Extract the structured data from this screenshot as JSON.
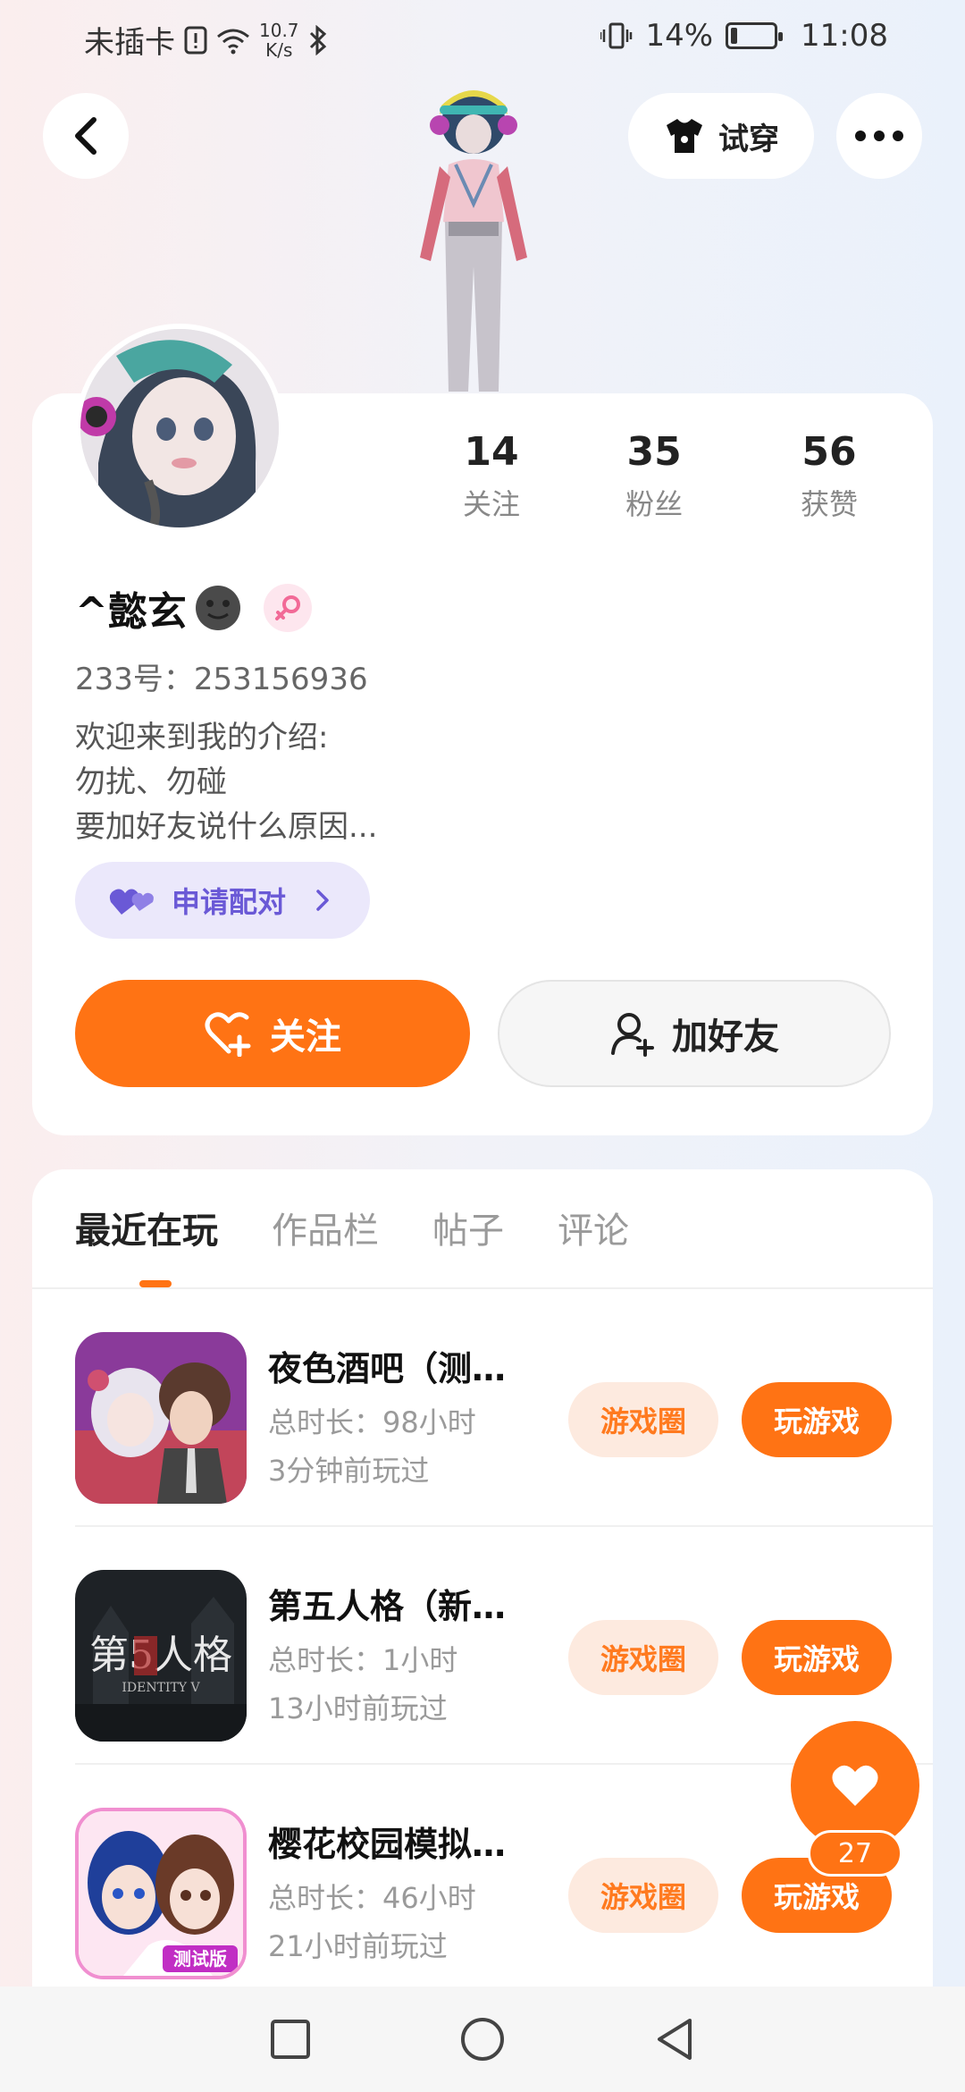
{
  "status_bar": {
    "carrier": "未插卡",
    "net_speed_value": "10.7",
    "net_speed_unit": "K/s",
    "battery_percent": "14%",
    "battery_level": 0.14,
    "time": "11:08"
  },
  "header": {
    "tryon_label": "试穿"
  },
  "profile": {
    "stats": [
      {
        "num": "14",
        "label": "关注"
      },
      {
        "num": "35",
        "label": "粉丝"
      },
      {
        "num": "56",
        "label": "获赞"
      }
    ],
    "name": "^懿玄",
    "uid": "233号：253156936",
    "bio": "欢迎来到我的介绍:\n勿扰、勿碰\n要加好友说什么原因...",
    "pair_label": "申请配对",
    "follow_label": "关注",
    "add_friend_label": "加好友"
  },
  "tabs": [
    {
      "label": "最近在玩",
      "active": true
    },
    {
      "label": "作品栏",
      "active": false
    },
    {
      "label": "帖子",
      "active": false
    },
    {
      "label": "评论",
      "active": false
    }
  ],
  "games": [
    {
      "title": "夜色酒吧（测试版）",
      "time": "总时长：98小时",
      "last": "3分钟前玩过",
      "circle_label": "游戏圈",
      "play_label": "玩游戏"
    },
    {
      "title": "第五人格（新版本）",
      "time": "总时长：1小时",
      "last": "13小时前玩过",
      "circle_label": "游戏圈",
      "play_label": "玩游戏"
    },
    {
      "title": "樱花校园模拟器（测试版）",
      "time": "总时长：46小时",
      "last": "21小时前玩过",
      "circle_label": "游戏圈",
      "play_label": "玩游戏"
    }
  ],
  "fab": {
    "count": "27"
  },
  "colors": {
    "accent": "#ff7314",
    "pair_bg": "#ebe8fb",
    "pair_text": "#6a59d6"
  }
}
